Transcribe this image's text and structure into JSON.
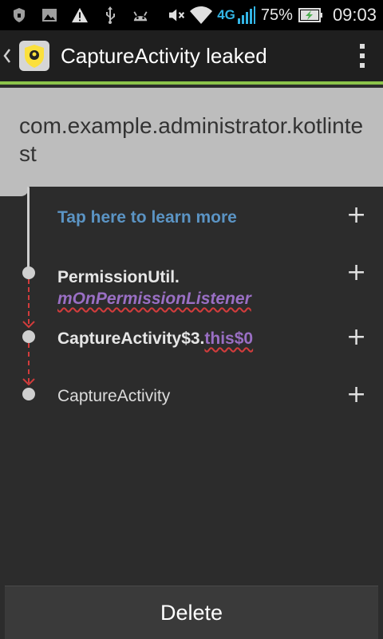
{
  "status_bar": {
    "network": "4G",
    "battery": "75%",
    "time": "09:03",
    "icons": [
      "shield-icon",
      "image-icon",
      "warning-icon",
      "usb-icon",
      "android-icon",
      "mute-icon",
      "wifi-icon",
      "signal-icon",
      "battery-charging-icon"
    ]
  },
  "action_bar": {
    "title": "CaptureActivity leaked",
    "accent_color": "#8bc34a"
  },
  "header": {
    "package_name": "com.example.administrator.kotlintest"
  },
  "trace": {
    "learn_more": "Tap here to learn more",
    "rows": [
      {
        "class": "PermissionUtil.",
        "field": "mOnPermissionListener"
      },
      {
        "class": "CaptureActivity$3.",
        "field": "this$0"
      },
      {
        "class": "CaptureActivity"
      }
    ],
    "expand_symbol": "+"
  },
  "footer": {
    "delete_label": "Delete"
  }
}
